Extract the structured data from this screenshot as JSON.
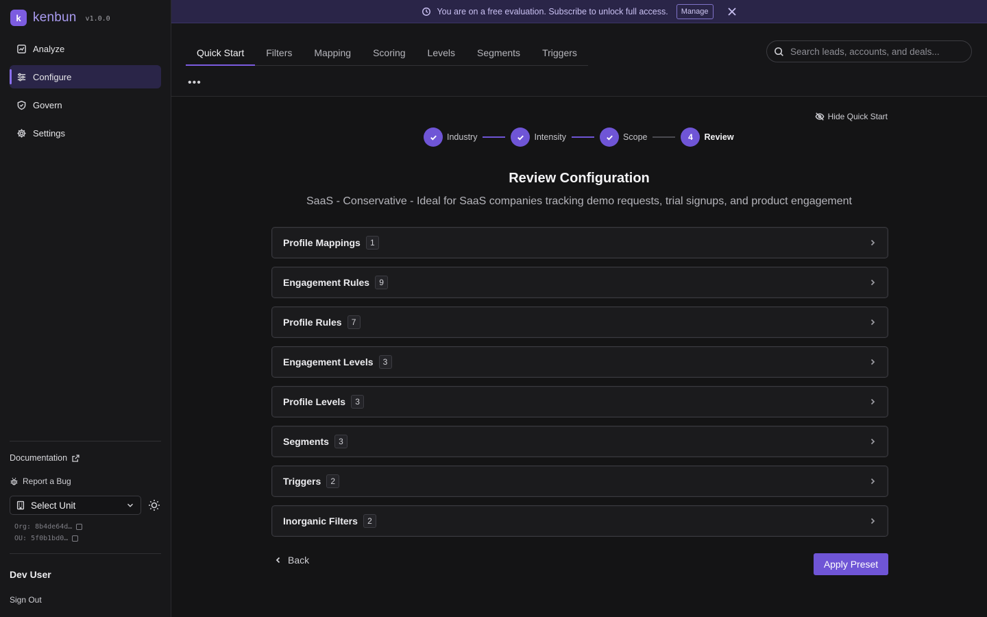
{
  "brand": {
    "name": "kenbun",
    "version": "v1.0.0",
    "logo_glyph": "k",
    "accent_color": "#7c5ce0"
  },
  "sidebar": {
    "items": [
      {
        "label": "Analyze",
        "icon": "chart-icon"
      },
      {
        "label": "Configure",
        "icon": "sliders-icon",
        "active": true
      },
      {
        "label": "Govern",
        "icon": "shield-icon"
      },
      {
        "label": "Settings",
        "icon": "gear-icon"
      }
    ],
    "documentation_label": "Documentation",
    "report_bug_label": "Report a Bug",
    "unit_select": {
      "value": "Select Unit"
    },
    "org_id": "Org: 8b4de64d…",
    "ou_id": "OU: 5f0b1bd0…",
    "user_name": "Dev User",
    "sign_out_label": "Sign Out"
  },
  "banner": {
    "message": "You are on a free evaluation. Subscribe to unlock full access.",
    "manage_label": "Manage"
  },
  "tabs": [
    {
      "label": "Quick Start",
      "active": true
    },
    {
      "label": "Filters"
    },
    {
      "label": "Mapping"
    },
    {
      "label": "Scoring"
    },
    {
      "label": "Levels"
    },
    {
      "label": "Segments"
    },
    {
      "label": "Triggers"
    }
  ],
  "more_label": "•••",
  "search": {
    "placeholder": "Search leads, accounts, and deals..."
  },
  "quick_start": {
    "hide_label": "Hide Quick Start",
    "steps": [
      {
        "label": "Industry",
        "status": "done"
      },
      {
        "label": "Intensity",
        "status": "done"
      },
      {
        "label": "Scope",
        "status": "done"
      },
      {
        "label": "Review",
        "status": "current",
        "number": "4"
      }
    ],
    "title": "Review Configuration",
    "subtitle": "SaaS - Conservative - Ideal for SaaS companies tracking demo requests, trial signups, and product engagement",
    "sections": [
      {
        "label": "Profile Mappings",
        "count": "1"
      },
      {
        "label": "Engagement Rules",
        "count": "9"
      },
      {
        "label": "Profile Rules",
        "count": "7"
      },
      {
        "label": "Engagement Levels",
        "count": "3"
      },
      {
        "label": "Profile Levels",
        "count": "3"
      },
      {
        "label": "Segments",
        "count": "3"
      },
      {
        "label": "Triggers",
        "count": "2"
      },
      {
        "label": "Inorganic Filters",
        "count": "2"
      }
    ],
    "back_label": "Back",
    "apply_label": "Apply Preset"
  }
}
